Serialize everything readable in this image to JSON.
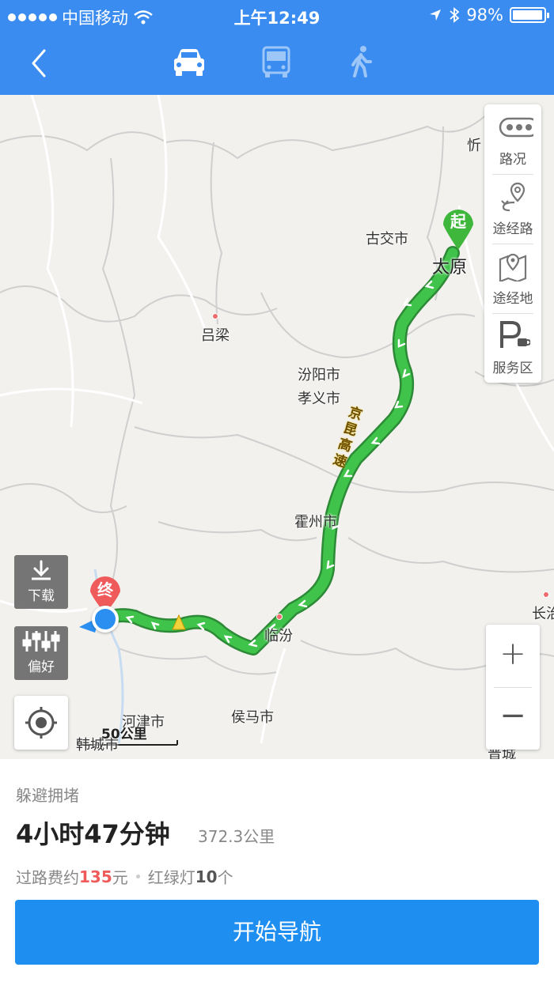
{
  "status_bar": {
    "carrier": "中国移动",
    "time": "上午12:49",
    "battery": "98%",
    "battery_level": 0.98
  },
  "nav": {
    "modes": [
      "car-icon",
      "bus-icon",
      "walk-icon"
    ],
    "active_mode": "car"
  },
  "map": {
    "start_marker": "起",
    "end_marker": "终",
    "cities": {
      "xin": "忻",
      "gujiao": "古交市",
      "taiyuan": "太原",
      "lvliang": "吕梁",
      "fenyang": "汾阳市",
      "xiaoyi": "孝义市",
      "huozhou": "霍州市",
      "linfen": "临汾",
      "houma": "侯马市",
      "hejin": "河津市",
      "hancheng": "韩城市",
      "changzhi": "长治",
      "puxian": "晋城"
    },
    "highway_label": "京昆高速",
    "scale_label": "50公里",
    "tools": [
      {
        "label": "路况",
        "icon": "traffic-icon"
      },
      {
        "label": "途经路",
        "icon": "via-road-icon"
      },
      {
        "label": "途经地",
        "icon": "via-place-icon"
      },
      {
        "label": "服务区",
        "icon": "service-area-icon"
      }
    ],
    "left_buttons": {
      "download": "下载",
      "preference": "偏好"
    },
    "zoom_in": "+",
    "zoom_out": "−"
  },
  "route": {
    "tag": "躲避拥堵",
    "duration": "4小时47分钟",
    "distance": "372.3公里",
    "toll_prefix": "过路费约",
    "toll_value": "135",
    "toll_suffix": "元",
    "lights_prefix": "红绿灯",
    "lights_value": "10",
    "lights_suffix": "个"
  },
  "start_button": "开始导航",
  "colors": {
    "header": "#3b8cf0",
    "route": "#3fc34a",
    "button": "#1e8ef0",
    "toll": "#ef5b5b"
  }
}
